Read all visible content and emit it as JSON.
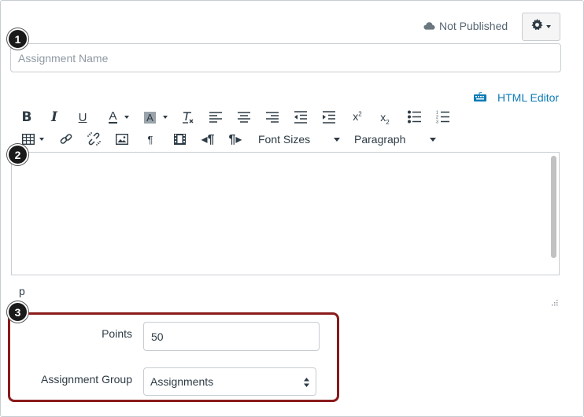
{
  "header": {
    "status_text": "Not Published",
    "status_icon": "cloud-icon",
    "settings_icon": "gear-icon"
  },
  "assignment_name": {
    "placeholder": "Assignment Name",
    "value": ""
  },
  "html_editor_link": {
    "label": "HTML Editor",
    "icon": "keyboard-icon",
    "color": "#0c7bb6"
  },
  "toolbar": {
    "row1_icons": [
      "bold-icon",
      "italic-icon",
      "underline-icon",
      "text-color-icon",
      "background-color-icon",
      "clear-formatting-icon",
      "align-left-icon",
      "align-center-icon",
      "align-right-icon",
      "outdent-icon",
      "indent-icon",
      "superscript-icon",
      "subscript-icon",
      "bullet-list-icon",
      "numbered-list-icon"
    ],
    "row2_icons": [
      "table-icon",
      "link-icon",
      "unlink-icon",
      "image-icon",
      "ltr-icon",
      "media-icon",
      "rtl-icon",
      "paragraph-icon"
    ],
    "font_sizes_label": "Font Sizes",
    "paragraph_label": "Paragraph"
  },
  "editor": {
    "content": "",
    "path_label": "p"
  },
  "points": {
    "label": "Points",
    "value": "50"
  },
  "assignment_group": {
    "label": "Assignment Group",
    "selected": "Assignments"
  },
  "callouts": [
    "1",
    "2",
    "3"
  ],
  "colors": {
    "highlight_border": "#8b1a1a",
    "link": "#0c7bb6",
    "text": "#2d3b45"
  }
}
